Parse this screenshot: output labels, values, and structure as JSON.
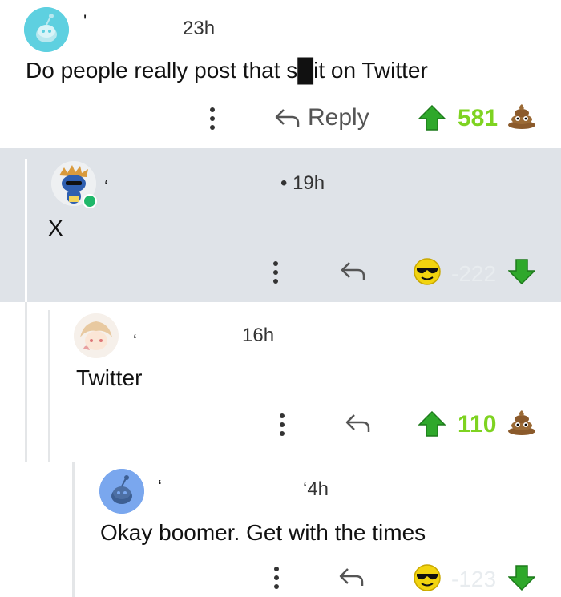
{
  "comments": [
    {
      "username": "'",
      "time": "23h",
      "body": "Do people really post that s█it on Twitter",
      "reply_label": "Reply",
      "score": "581",
      "vote_icon": "up-arrow-icon",
      "reaction_icon": "poop-icon"
    },
    {
      "username": "ʻ",
      "time": "• 19h",
      "body": "X",
      "score": "-222",
      "vote_icon": "down-arrow-icon",
      "reaction_icon": "sunglasses-face-icon"
    },
    {
      "username": "ʻ",
      "time": "16h",
      "body": "Twitter",
      "score": "110",
      "vote_icon": "up-arrow-icon",
      "reaction_icon": "poop-icon"
    },
    {
      "username": "ʻ",
      "time": "‘4h",
      "body": "Okay boomer. Get with the times",
      "score": "-123",
      "vote_icon": "down-arrow-icon",
      "reaction_icon": "sunglasses-face-icon"
    }
  ],
  "colors": {
    "upvote_green": "#7ed321",
    "downvote_green": "#2fa82b",
    "highlight_bg": "#dfe3e8",
    "thread_line": "#e4e6e8"
  }
}
